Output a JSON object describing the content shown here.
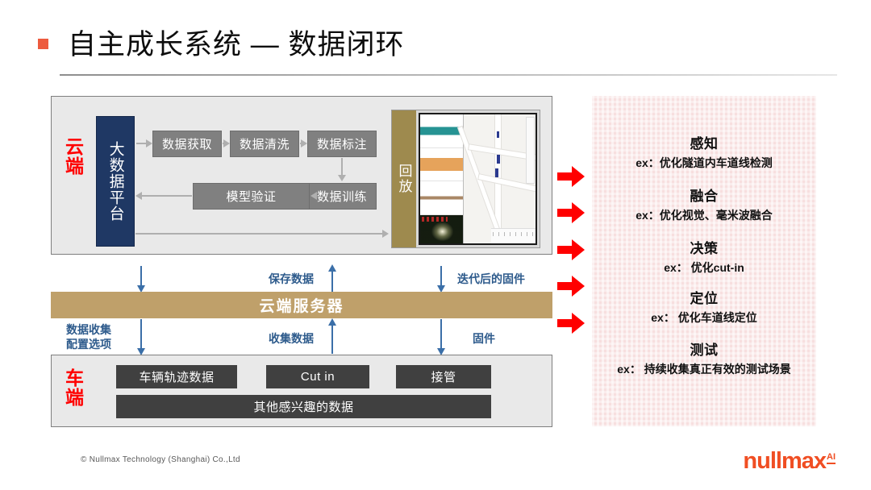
{
  "slide": {
    "title": "自主成长系统 — 数据闭环",
    "bullet_color": "#ED5B3E"
  },
  "cloud_section": {
    "side_label": "云端",
    "platform_label": "大数据平台",
    "pipeline": [
      {
        "id": "acq",
        "label": "数据获取"
      },
      {
        "id": "clean",
        "label": "数据清洗"
      },
      {
        "id": "annot",
        "label": "数据标注"
      },
      {
        "id": "train",
        "label": "数据训练"
      },
      {
        "id": "valid",
        "label": "模型验证"
      }
    ],
    "playback_label": "回放"
  },
  "server": {
    "label": "云端服务器",
    "color": "#BFA06A"
  },
  "flow_labels": {
    "save_data": "保存数据",
    "iterated_firmware": "迭代后的固件",
    "collect_config": "数据收集\n配置选项",
    "collect_config_line1": "数据收集",
    "collect_config_line2": "配置选项",
    "collect_data": "收集数据",
    "firmware": "固件"
  },
  "vehicle_section": {
    "side_label": "车端",
    "items": [
      {
        "id": "traj",
        "label": "车辆轨迹数据"
      },
      {
        "id": "cutin",
        "label": "Cut in"
      },
      {
        "id": "take",
        "label": "接管"
      },
      {
        "id": "other",
        "label": "其他感兴趣的数据"
      }
    ]
  },
  "capabilities": {
    "background_color": "#F7DFDF",
    "arrow_color": "#FF0000",
    "items": [
      {
        "heading": "感知",
        "example": "ex：优化隧道内车道线检测"
      },
      {
        "heading": "融合",
        "example": "ex：优化视觉、毫米波融合"
      },
      {
        "heading": "决策",
        "example": "ex： 优化cut-in"
      },
      {
        "heading": "定位",
        "example": "ex： 优化车道线定位"
      },
      {
        "heading": "测试",
        "example": "ex： 持续收集真正有效的测试场景"
      }
    ]
  },
  "footer": {
    "copyright": "© Nullmax Technology (Shanghai) Co.,Ltd",
    "logo_text": "nullmax",
    "logo_superscript": "AI",
    "logo_color": "#F04E23"
  }
}
